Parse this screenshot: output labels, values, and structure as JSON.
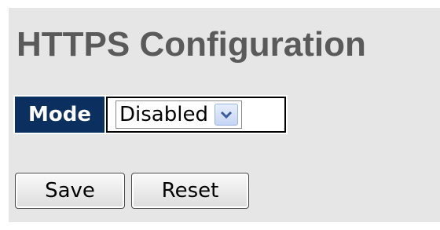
{
  "page": {
    "title": "HTTPS Configuration"
  },
  "mode": {
    "label": "Mode",
    "selected": "Disabled"
  },
  "buttons": {
    "save": "Save",
    "reset": "Reset"
  },
  "colors": {
    "label_bg": "#0b2f5e",
    "panel_bg": "#e6e6e6",
    "title_text": "#5a5a5a"
  },
  "icons": {
    "select_arrow": "chevron-down-icon"
  }
}
